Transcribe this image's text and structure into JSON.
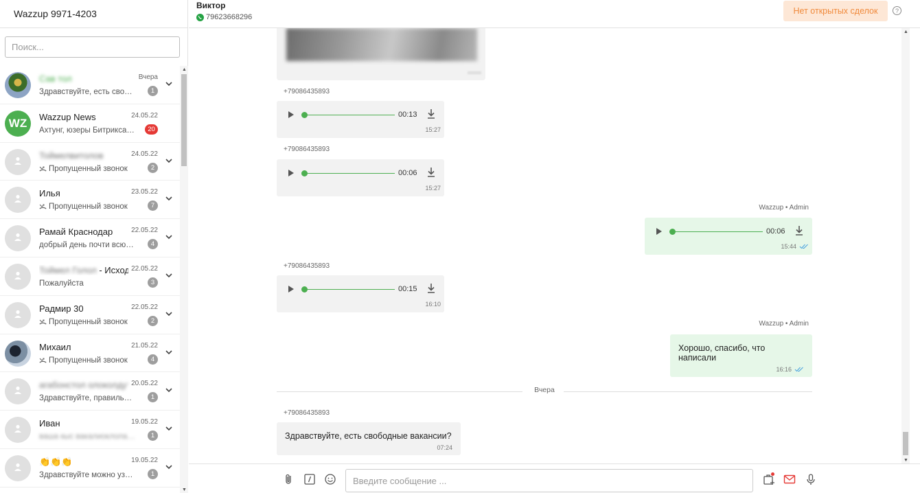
{
  "account": {
    "title": "Wazzup 9971-4203"
  },
  "search": {
    "placeholder": "Поиск..."
  },
  "chats": [
    {
      "name": "Сав тол",
      "blurred": true,
      "green": true,
      "avatar": "photo1",
      "preview": "Здравствуйте, есть свобо...",
      "date": "Вчера",
      "badge": "1",
      "missed": false
    },
    {
      "name": "Wazzup News",
      "blurred": false,
      "avatar": "wz",
      "avatar_text": "WZ",
      "preview": "Ахтунг, юзеры Битрикса! ...",
      "date": "24.05.22",
      "badge": "20",
      "badge_red": true,
      "missed": false
    },
    {
      "name": "Тоймелвитолов",
      "blurred": true,
      "avatar": "default",
      "preview": "Пропущенный звонок",
      "date": "24.05.22",
      "badge": "2",
      "missed": true
    },
    {
      "name": "Илья",
      "blurred": false,
      "avatar": "default",
      "preview": "Пропущенный звонок",
      "date": "23.05.22",
      "badge": "7",
      "missed": true
    },
    {
      "name": "Рамай Краснодар",
      "blurred": false,
      "avatar": "default",
      "preview": "добрый день почти всю н...",
      "date": "22.05.22",
      "badge": "4",
      "missed": false
    },
    {
      "name": "Тоймел Голол - Исход...",
      "blurred": false,
      "partial_blur": true,
      "avatar": "default",
      "preview": "Пожалуйста",
      "date": "22.05.22",
      "badge": "3",
      "missed": false
    },
    {
      "name": "Радмир 30",
      "blurred": false,
      "avatar": "default",
      "preview": "Пропущенный звонок",
      "date": "22.05.22",
      "badge": "2",
      "missed": true
    },
    {
      "name": "Михаил",
      "blurred": false,
      "avatar": "photo2",
      "preview": "Пропущенный звонок",
      "date": "21.05.22",
      "badge": "4",
      "missed": true
    },
    {
      "name": "агабонстол олоколдут",
      "blurred": true,
      "avatar": "default",
      "preview": "Здравствуйте, правильно ...",
      "date": "20.05.22",
      "badge": "1",
      "missed": false
    },
    {
      "name": "Иван",
      "blurred": false,
      "avatar": "default",
      "preview": "ваша кыс вакалиоклоладот",
      "preview_blurred": true,
      "date": "19.05.22",
      "badge": "1",
      "missed": false
    },
    {
      "name": "👏👏👏",
      "blurred": false,
      "avatar": "default",
      "preview": "Здравствуйте можно узна...",
      "date": "19.05.22",
      "badge": "1",
      "missed": false
    }
  ],
  "header": {
    "contact_name": "Виктор",
    "contact_phone": "79623668296",
    "deal_button": "Нет открытых сделок",
    "help_label": "?"
  },
  "messages": {
    "voice1": {
      "sender": "+79086435893",
      "duration": "00:13",
      "time": "15:27"
    },
    "voice2": {
      "sender": "+79086435893",
      "duration": "00:06",
      "time": "15:27"
    },
    "voice3": {
      "sender": "Wazzup • Admin",
      "duration": "00:06",
      "time": "15:44"
    },
    "voice4": {
      "sender": "+79086435893",
      "duration": "00:15",
      "time": "16:10"
    },
    "text1": {
      "sender": "Wazzup • Admin",
      "text": "Хорошо, спасибо, что написали",
      "time": "16:16"
    },
    "day_separator": "Вчера",
    "text2": {
      "sender": "+79086435893",
      "text": "Здравствуйте, есть свободные вакансии?",
      "time": "07:24"
    }
  },
  "composer": {
    "placeholder": "Введите сообщение ..."
  },
  "colors": {
    "accent": "#4caf50",
    "badge_red": "#e53935",
    "deal_bg": "#fde7d6",
    "deal_text": "#f08a3c",
    "out_bubble": "#e6f7e8",
    "in_bubble": "#f2f2f2"
  },
  "icons": [
    "chevron-down-icon",
    "missed-call-icon",
    "whatsapp-icon",
    "help-icon",
    "play-icon",
    "download-icon",
    "double-check-icon",
    "attach-icon",
    "template-icon",
    "emoji-icon",
    "add-deal-icon",
    "mail-icon",
    "microphone-icon"
  ]
}
